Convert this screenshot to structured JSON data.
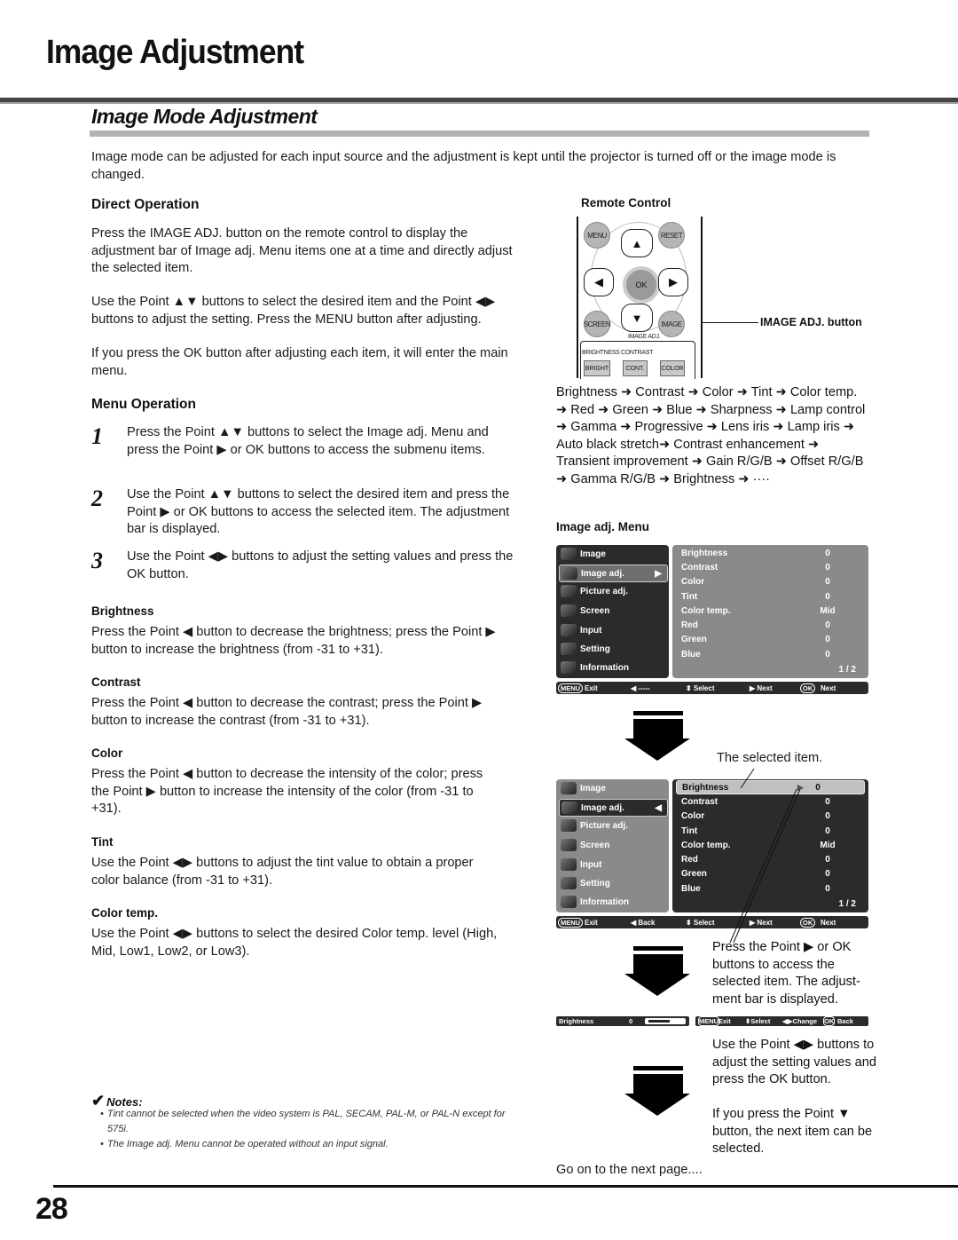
{
  "header": {
    "page_title": "Image Adjustment",
    "section_title": "Image Mode Adjustment",
    "intro": "Image mode can be adjusted for each input source and the adjustment is kept until the projector is turned off or the image mode is changed."
  },
  "direct_operation": {
    "heading": "Direct Operation",
    "para1": "Press the IMAGE ADJ. button on the remote control to display the adjustment bar of Image adj. Menu items one at a time and directly adjust the selected item.",
    "para2": "Use the Point ▲▼ buttons to select the desired item and the Point ◀▶ buttons to adjust the setting. Press the MENU button after adjusting.",
    "para3": "If you press the OK button after adjusting each item, it will enter the main menu."
  },
  "menu_operation": {
    "heading": "Menu Operation",
    "steps": [
      {
        "num": "1",
        "text": "Press the Point ▲▼ buttons to select the Image adj. Menu and press the Point ▶ or OK buttons to access the submenu items."
      },
      {
        "num": "2",
        "text": "Use the Point ▲▼ buttons to select the desired item and press the Point ▶ or OK buttons to access the selected item. The adjustment bar is displayed."
      },
      {
        "num": "3",
        "text": "Use the Point ◀▶ buttons to adjust the setting values and press the OK button."
      }
    ]
  },
  "items": [
    {
      "heading": "Brightness",
      "text": "Press the Point ◀ button to decrease the brightness; press the Point ▶ button to increase the brightness (from -31 to +31)."
    },
    {
      "heading": "Contrast",
      "text": "Press the Point ◀ button to decrease the contrast; press the Point ▶ button to increase the contrast (from -31 to +31)."
    },
    {
      "heading": "Color",
      "text": "Press the Point ◀ button to decrease the intensity of the color; press the Point ▶ button to increase the intensity of the color (from -31 to +31)."
    },
    {
      "heading": "Tint",
      "text": "Use the Point ◀▶ buttons to adjust the tint value to obtain a proper color balance (from -31 to +31)."
    },
    {
      "heading": "Color temp.",
      "text": "Use the Point ◀▶ buttons to select the desired Color temp. level (High, Mid, Low1, Low2, or Low3)."
    }
  ],
  "notes": {
    "heading": "Notes:",
    "items": [
      "Tint cannot be selected when the video system is PAL, SECAM, PAL-M, or PAL-N except for 575i.",
      "The Image adj. Menu cannot be operated without an input signal."
    ]
  },
  "remote": {
    "caption": "Remote Control",
    "menu": "MENU",
    "reset": "RESET",
    "ok": "OK",
    "screen": "SCREEN",
    "image": "IMAGE",
    "image_adj": "IMAGE ADJ.",
    "brightness": "BRIGHTNESS",
    "contrast": "CONTRAST",
    "bright": "BRIGHT",
    "cont": "CONT.",
    "color": "COLOR",
    "callout": "IMAGE ADJ. button",
    "up": "▲",
    "down": "▼",
    "left": "◀",
    "right": "▶"
  },
  "flow_text": "Brightness ➜ Contrast ➜ Color ➜ Tint ➜ Color temp. ➜ Red ➜ Green ➜ Blue ➜ Sharpness ➜ Lamp control ➜ Gamma ➜ Progressive ➜ Lens iris ➜ Lamp iris ➜ Auto black stretch➜ Contrast enhancement ➜ Transient improvement ➜ Gain R/G/B ➜ Offset R/G/B ➜ Gamma R/G/B ➜ Brightness ➜ ····",
  "menu_caption": "Image adj. Menu",
  "osd": {
    "left_items": [
      "Image",
      "Image adj.",
      "Picture adj.",
      "Screen",
      "Input",
      "Setting",
      "Information"
    ],
    "right_items": [
      {
        "label": "Brightness",
        "value": "0"
      },
      {
        "label": "Contrast",
        "value": "0"
      },
      {
        "label": "Color",
        "value": "0"
      },
      {
        "label": "Tint",
        "value": "0"
      },
      {
        "label": "Color temp.",
        "value": "Mid"
      },
      {
        "label": "Red",
        "value": "0"
      },
      {
        "label": "Green",
        "value": "0"
      },
      {
        "label": "Blue",
        "value": "0"
      }
    ],
    "page": "1 / 2",
    "bar1": {
      "menu": "MENU",
      "exit": "Exit",
      "back": "◀ -----",
      "select": "⬍ Select",
      "next": "▶ Next",
      "ok": "OK",
      "ok_next": "Next"
    },
    "bar2": {
      "menu": "MENU",
      "exit": "Exit",
      "back": "◀ Back",
      "select": "⬍ Select",
      "next": "▶ Next",
      "ok": "OK",
      "ok_next": "Next"
    },
    "adj": {
      "label": "Brightness",
      "value": "0",
      "level": 0.5,
      "menu": "MENU",
      "exit": "Exit",
      "select": "⬍Select",
      "change": "◀▶Change",
      "ok": "OK",
      "back": "Back"
    }
  },
  "annotations": {
    "selected_item": "The selected item.",
    "press_point": "Press the Point ▶ or OK buttons to access the selected item. The adjust-ment bar is displayed.",
    "use_point": "Use the Point ◀▶ buttons to adjust the setting values and press the OK button.",
    "press_down": "If you press the Point ▼ button, the next item can be selected.",
    "next_page": "Go on to the next page...."
  },
  "footer": {
    "page_number": "28"
  }
}
